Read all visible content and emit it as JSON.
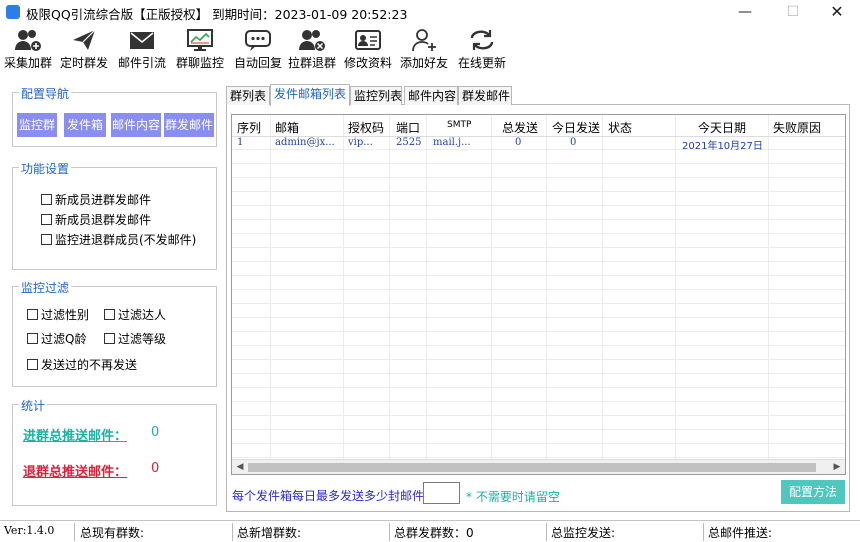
{
  "window": {
    "title": "极限QQ引流综合版【正版授权】 到期时间：2023-01-09 20:52:23"
  },
  "toolbar": {
    "items": [
      {
        "label": "采集加群",
        "icon": "users-add-icon"
      },
      {
        "label": "定时群发",
        "icon": "send-icon"
      },
      {
        "label": "邮件引流",
        "icon": "mail-icon"
      },
      {
        "label": "群聊监控",
        "icon": "monitor-icon"
      },
      {
        "label": "自动回复",
        "icon": "chat-bubble-icon"
      },
      {
        "label": "拉群退群",
        "icon": "group-exit-icon"
      },
      {
        "label": "修改资料",
        "icon": "profile-card-icon"
      },
      {
        "label": "添加好友",
        "icon": "add-friend-icon"
      },
      {
        "label": "在线更新",
        "icon": "refresh-icon"
      }
    ]
  },
  "nav": {
    "legend": "配置导航",
    "buttons": [
      "监控群",
      "发件箱",
      "邮件内容",
      "群发邮件"
    ]
  },
  "features": {
    "legend": "功能设置",
    "options": [
      "新成员进群发邮件",
      "新成员退群发邮件",
      "监控进退群成员(不发邮件)"
    ]
  },
  "filters": {
    "legend": "监控过滤",
    "options": [
      "过滤性别",
      "过滤达人",
      "过滤Q龄",
      "过滤等级",
      "发送过的不再发送"
    ]
  },
  "stats": {
    "legend": "统计",
    "join_label": "进群总推送邮件：",
    "join_value": "0",
    "leave_label": "退群总推送邮件：",
    "leave_value": "0"
  },
  "tabs": [
    "群列表",
    "发件邮箱列表",
    "监控列表",
    "邮件内容",
    "群发邮件"
  ],
  "active_tab": 1,
  "table": {
    "columns": [
      "序列",
      "邮箱",
      "授权码",
      "端口",
      "SMTP",
      "总发送",
      "今日发送",
      "状态",
      "今天日期",
      "失败原因"
    ],
    "rows": [
      [
        "1",
        "admin@jx...",
        "vip...",
        "2525",
        "mail.j...",
        "0",
        "0",
        "",
        "2021年10月27日",
        ""
      ]
    ]
  },
  "bottom": {
    "question": "每个发件箱每日最多发送多少封邮件?",
    "input_value": "",
    "hint": "* 不需要时请留空",
    "config_button": "配置方法"
  },
  "statusbar": {
    "version": "Ver:1.4.0",
    "total_groups": "总现有群数:",
    "new_groups": "总新增群数:",
    "mass_count": "总群发群数：0",
    "monitor_sent": "总监控发送:",
    "mail_push": "总邮件推送:"
  },
  "colors": {
    "accent": "#1f63c8",
    "nav_button": "#8a8ef0",
    "join_stat": "#19b3a6",
    "leave_stat": "#e0203a",
    "config_button": "#4fc7bf"
  }
}
